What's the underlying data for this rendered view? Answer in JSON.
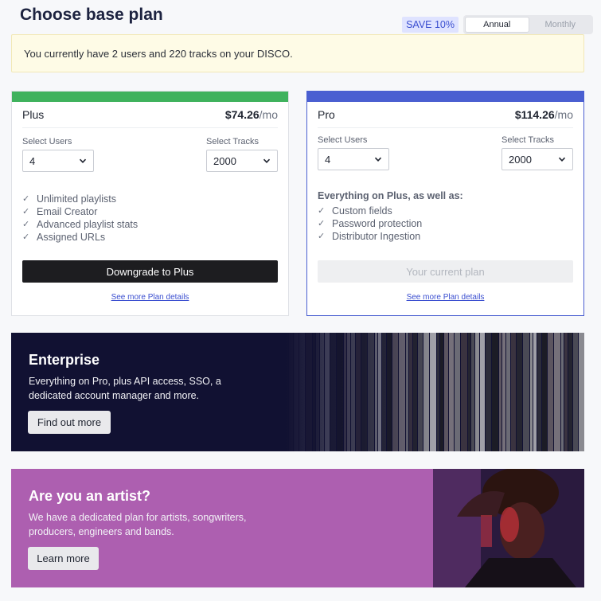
{
  "header": {
    "title": "Choose base plan",
    "save_badge": "SAVE 10%",
    "billing_options": [
      "Annual",
      "Monthly"
    ],
    "selected_billing": "Annual"
  },
  "notice": "You currently have 2 users and 220 tracks on your DISCO.",
  "plans": [
    {
      "name": "Plus",
      "price": "$74.26",
      "price_unit": "/mo",
      "users_label": "Select Users",
      "users_value": "4",
      "tracks_label": "Select Tracks",
      "tracks_value": "2000",
      "features_lead": "",
      "features": [
        "Unlimited playlists",
        "Email Creator",
        "Advanced playlist stats",
        "Assigned URLs"
      ],
      "button": "Downgrade to Plus",
      "details_link": "See more Plan details",
      "accent": "#3fb25d"
    },
    {
      "name": "Pro",
      "price": "$114.26",
      "price_unit": "/mo",
      "users_label": "Select Users",
      "users_value": "4",
      "tracks_label": "Select Tracks",
      "tracks_value": "2000",
      "features_lead": "Everything on Plus, as well as:",
      "features": [
        "Custom fields",
        "Password protection",
        "Distributor Ingestion"
      ],
      "button": "Your current plan",
      "details_link": "See more Plan details",
      "accent": "#4a5fd1"
    }
  ],
  "enterprise": {
    "title": "Enterprise",
    "text": "Everything on Pro, plus API access, SSO, a dedicated account manager and more.",
    "button": "Find out more"
  },
  "artist": {
    "title": "Are you an artist?",
    "text": "We have a dedicated plan for artists, songwriters, producers, engineers and bands.",
    "button": "Learn more"
  },
  "icons": {
    "check": "check-icon",
    "chevron": "chevron-down-icon"
  }
}
